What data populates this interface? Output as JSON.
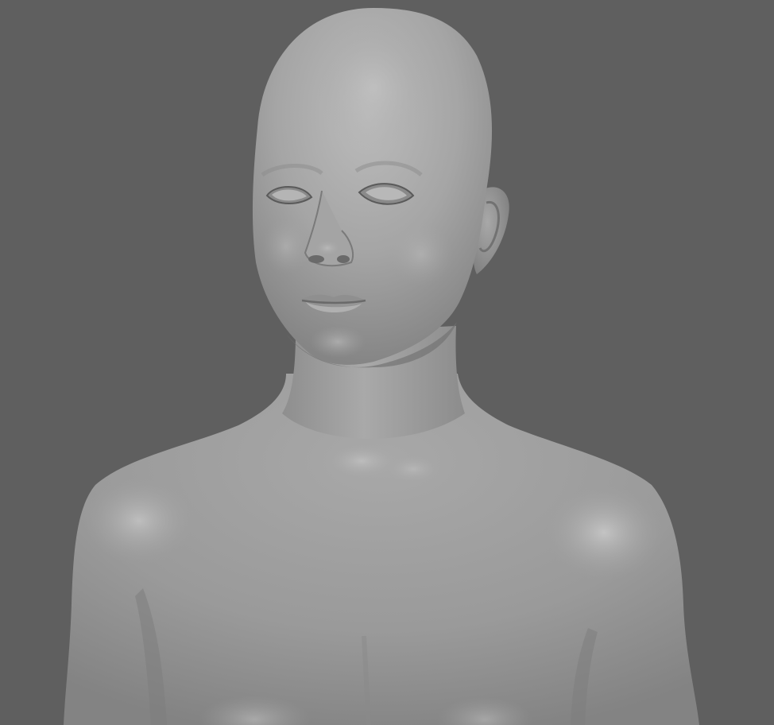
{
  "viewport": {
    "background_color": "#5f5f5f",
    "model_base_color": "#9c9c9c",
    "model_highlight_color": "#bdbdbd",
    "model_shadow_color": "#6f6f6f"
  }
}
